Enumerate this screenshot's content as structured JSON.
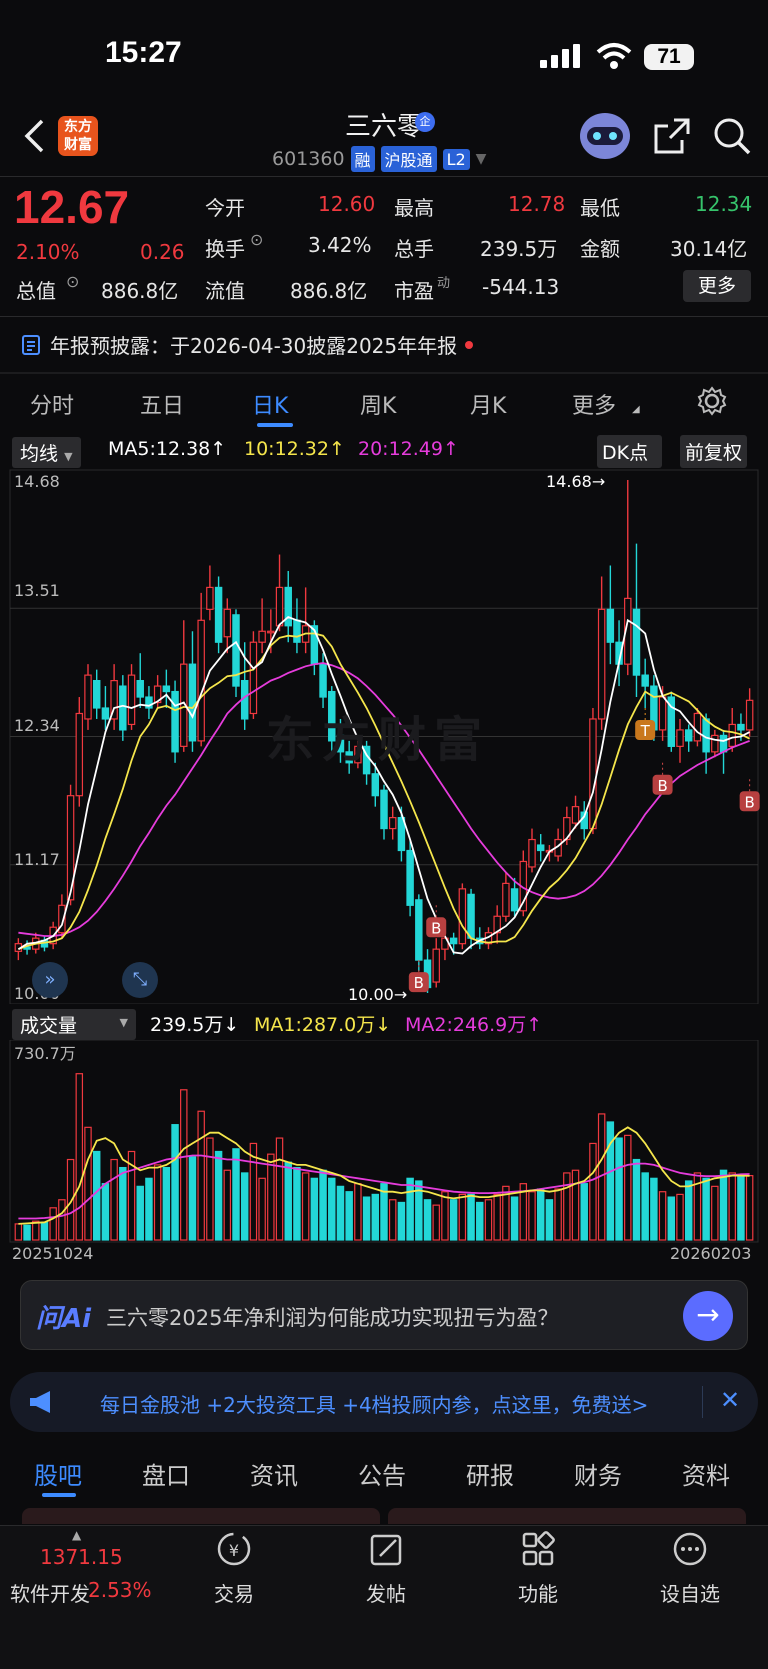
{
  "status_bar": {
    "time": "15:27",
    "battery": "71"
  },
  "header": {
    "stock_name": "三六零",
    "corp_badge": "企",
    "code": "601360",
    "tags": [
      "融",
      "沪股通",
      "L2"
    ],
    "logo_line1": "东方",
    "logo_line2": "财富"
  },
  "quote": {
    "price": "12.67",
    "change_pct": "2.10%",
    "change": "0.26",
    "fields": [
      {
        "label": "今开",
        "value": "12.60",
        "color": "red"
      },
      {
        "label": "最高",
        "value": "12.78",
        "color": "red"
      },
      {
        "label": "最低",
        "value": "12.34",
        "color": "green"
      },
      {
        "label": "换手",
        "value": "3.42%",
        "color": "white"
      },
      {
        "label": "总手",
        "value": "239.5万",
        "color": "white"
      },
      {
        "label": "金额",
        "value": "30.14亿",
        "color": "white"
      },
      {
        "label": "总值",
        "value": "886.8亿",
        "color": "white"
      },
      {
        "label": "流值",
        "value": "886.8亿",
        "color": "white"
      },
      {
        "label": "市盈",
        "label_sup": "动",
        "value": "-544.13",
        "color": "white"
      }
    ],
    "more": "更多"
  },
  "notice": {
    "text": "年报预披露：于2026-04-30披露2025年年报"
  },
  "kline_tabs": [
    "分时",
    "五日",
    "日K",
    "周K",
    "月K",
    "更多"
  ],
  "active_tab": "日K",
  "ma_bar": {
    "selector": "均线",
    "ma5": "MA5:12.38",
    "ma10": "10:12.32",
    "ma20": "20:12.49",
    "dk": "DK点",
    "adjust": "前复权"
  },
  "chart_data": [
    {
      "type": "candlestick",
      "y_ticks": [
        "14.68",
        "13.51",
        "12.34",
        "11.17",
        "10.00"
      ],
      "ylim": [
        10.0,
        14.68
      ],
      "max_label": "14.68",
      "min_label": "10.00",
      "series_colors": {
        "up": "#f0393f",
        "down": "#23d7d7",
        "ma5": "#ffffff",
        "ma10": "#f5e64c",
        "ma20": "#e63cdc"
      },
      "candles": [
        [
          10.38,
          10.45,
          10.3,
          10.5
        ],
        [
          10.42,
          10.4,
          10.35,
          10.48
        ],
        [
          10.4,
          10.5,
          10.36,
          10.55
        ],
        [
          10.48,
          10.42,
          10.38,
          10.52
        ],
        [
          10.45,
          10.6,
          10.4,
          10.65
        ],
        [
          10.55,
          10.8,
          10.5,
          10.9
        ],
        [
          10.85,
          11.8,
          10.8,
          11.9
        ],
        [
          11.8,
          12.55,
          11.7,
          12.7
        ],
        [
          12.5,
          12.9,
          12.4,
          13.0
        ],
        [
          12.85,
          12.6,
          12.5,
          12.95
        ],
        [
          12.6,
          12.5,
          12.4,
          12.8
        ],
        [
          12.5,
          12.85,
          12.4,
          13.0
        ],
        [
          12.8,
          12.4,
          12.3,
          12.9
        ],
        [
          12.45,
          12.9,
          12.4,
          13.0
        ],
        [
          12.85,
          12.7,
          12.6,
          13.1
        ],
        [
          12.7,
          12.6,
          12.5,
          12.8
        ],
        [
          12.65,
          12.8,
          12.6,
          12.9
        ],
        [
          12.8,
          12.75,
          12.6,
          12.95
        ],
        [
          12.75,
          12.2,
          12.1,
          12.85
        ],
        [
          12.25,
          13.0,
          12.2,
          13.4
        ],
        [
          13.0,
          12.3,
          12.2,
          13.3
        ],
        [
          12.3,
          13.4,
          12.25,
          13.65
        ],
        [
          13.5,
          13.7,
          13.4,
          13.9
        ],
        [
          13.7,
          13.2,
          13.1,
          13.8
        ],
        [
          13.25,
          13.5,
          13.1,
          13.6
        ],
        [
          13.45,
          12.8,
          12.7,
          13.5
        ],
        [
          12.85,
          12.5,
          12.4,
          13.2
        ],
        [
          12.55,
          13.2,
          12.5,
          13.3
        ],
        [
          13.2,
          13.3,
          13.1,
          13.6
        ],
        [
          13.3,
          13.3,
          13.1,
          13.5
        ],
        [
          13.35,
          13.7,
          13.3,
          14.0
        ],
        [
          13.7,
          13.35,
          13.2,
          13.85
        ],
        [
          13.4,
          13.2,
          13.1,
          13.6
        ],
        [
          13.2,
          13.35,
          13.1,
          13.7
        ],
        [
          13.35,
          13.0,
          12.9,
          13.4
        ],
        [
          13.0,
          12.7,
          12.6,
          13.1
        ],
        [
          12.75,
          12.3,
          12.2,
          12.8
        ],
        [
          12.35,
          12.2,
          12.1,
          12.5
        ],
        [
          12.2,
          12.1,
          12.0,
          12.3
        ],
        [
          12.1,
          12.25,
          12.05,
          12.3
        ],
        [
          12.25,
          12.0,
          11.9,
          12.3
        ],
        [
          12.0,
          11.8,
          11.7,
          12.1
        ],
        [
          11.85,
          11.5,
          11.4,
          11.9
        ],
        [
          11.5,
          11.6,
          11.4,
          11.7
        ],
        [
          11.6,
          11.3,
          11.2,
          11.7
        ],
        [
          11.3,
          10.8,
          10.7,
          11.4
        ],
        [
          10.85,
          10.3,
          10.2,
          10.9
        ],
        [
          10.3,
          10.05,
          10.0,
          10.4
        ],
        [
          10.1,
          10.4,
          10.05,
          10.5
        ],
        [
          10.4,
          10.5,
          10.3,
          10.6
        ],
        [
          10.5,
          10.45,
          10.35,
          10.55
        ],
        [
          10.45,
          10.95,
          10.4,
          11.0
        ],
        [
          10.9,
          10.5,
          10.4,
          10.95
        ],
        [
          10.5,
          10.45,
          10.4,
          10.6
        ],
        [
          10.45,
          10.55,
          10.4,
          10.6
        ],
        [
          10.55,
          10.7,
          10.45,
          10.8
        ],
        [
          10.7,
          11.0,
          10.65,
          11.1
        ],
        [
          10.95,
          10.75,
          10.7,
          11.05
        ],
        [
          10.75,
          11.2,
          10.7,
          11.3
        ],
        [
          11.15,
          11.4,
          11.1,
          11.5
        ],
        [
          11.35,
          11.3,
          11.2,
          11.45
        ],
        [
          11.3,
          11.3,
          11.2,
          11.35
        ],
        [
          11.25,
          11.4,
          11.2,
          11.5
        ],
        [
          11.4,
          11.6,
          11.35,
          11.7
        ],
        [
          11.55,
          11.7,
          11.5,
          11.8
        ],
        [
          11.65,
          11.5,
          11.4,
          11.75
        ],
        [
          11.5,
          12.5,
          11.45,
          12.6
        ],
        [
          12.5,
          13.5,
          12.4,
          13.8
        ],
        [
          13.5,
          13.2,
          13.0,
          13.9
        ],
        [
          13.2,
          13.0,
          12.8,
          13.4
        ],
        [
          13.0,
          13.6,
          12.9,
          14.68
        ],
        [
          13.5,
          12.9,
          12.7,
          14.1
        ],
        [
          12.9,
          12.8,
          12.6,
          13.05
        ],
        [
          12.8,
          12.4,
          12.3,
          12.9
        ],
        [
          12.4,
          12.7,
          12.3,
          12.8
        ],
        [
          12.7,
          12.25,
          12.2,
          12.75
        ],
        [
          12.25,
          12.4,
          12.1,
          12.5
        ],
        [
          12.4,
          12.3,
          12.2,
          12.45
        ],
        [
          12.3,
          12.55,
          12.25,
          12.6
        ],
        [
          12.5,
          12.2,
          12.0,
          12.55
        ],
        [
          12.2,
          12.35,
          12.15,
          12.4
        ],
        [
          12.35,
          12.2,
          12.0,
          12.4
        ],
        [
          12.25,
          12.45,
          12.2,
          12.6
        ],
        [
          12.45,
          12.4,
          12.3,
          12.55
        ],
        [
          12.4,
          12.67,
          12.34,
          12.78
        ]
      ],
      "ma5": [
        10.4,
        10.45,
        10.46,
        10.48,
        10.52,
        10.62,
        10.92,
        11.3,
        11.72,
        12.05,
        12.38,
        12.6,
        12.62,
        12.6,
        12.63,
        12.62,
        12.66,
        12.72,
        12.62,
        12.65,
        12.52,
        12.73,
        12.94,
        13.04,
        13.14,
        13.2,
        13.06,
        12.96,
        13.02,
        13.2,
        13.36,
        13.43,
        13.4,
        13.38,
        13.31,
        13.13,
        12.91,
        12.71,
        12.5,
        12.32,
        12.17,
        12.07,
        11.93,
        11.81,
        11.64,
        11.4,
        11.13,
        10.86,
        10.68,
        10.52,
        10.37,
        10.36,
        10.43,
        10.48,
        10.51,
        10.56,
        10.61,
        10.69,
        10.83,
        10.99,
        11.15,
        11.29,
        11.34,
        11.41,
        11.52,
        11.61,
        11.83,
        12.22,
        12.66,
        13.02,
        13.4,
        13.35,
        13.28,
        12.95,
        12.71,
        12.61,
        12.57,
        12.47,
        12.38,
        12.33,
        12.31,
        12.3,
        12.33,
        12.34,
        12.38
      ],
      "ma10": [
        10.4,
        10.43,
        10.45,
        10.46,
        10.47,
        10.5,
        10.6,
        10.74,
        10.94,
        11.16,
        11.41,
        11.63,
        11.86,
        12.12,
        12.34,
        12.45,
        12.6,
        12.62,
        12.58,
        12.61,
        12.6,
        12.7,
        12.78,
        12.83,
        12.89,
        12.9,
        12.93,
        12.95,
        13.05,
        13.17,
        13.24,
        13.26,
        13.25,
        13.28,
        13.28,
        13.26,
        13.16,
        13.0,
        12.87,
        12.74,
        12.6,
        12.44,
        12.27,
        12.1,
        11.93,
        11.75,
        11.56,
        11.36,
        11.16,
        10.96,
        10.77,
        10.61,
        10.5,
        10.47,
        10.46,
        10.47,
        10.47,
        10.51,
        10.62,
        10.75,
        10.86,
        10.96,
        11.03,
        11.12,
        11.23,
        11.37,
        11.51,
        11.72,
        11.97,
        12.22,
        12.45,
        12.61,
        12.75,
        12.7,
        12.71,
        12.74,
        12.7,
        12.66,
        12.58,
        12.49,
        12.43,
        12.39,
        12.38,
        12.36,
        12.32
      ],
      "ma20": [
        10.55,
        10.54,
        10.53,
        10.52,
        10.52,
        10.53,
        10.56,
        10.6,
        10.66,
        10.74,
        10.84,
        10.95,
        11.07,
        11.2,
        11.34,
        11.46,
        11.59,
        11.71,
        11.81,
        11.93,
        12.05,
        12.17,
        12.3,
        12.42,
        12.55,
        12.63,
        12.7,
        12.75,
        12.8,
        12.85,
        12.88,
        12.92,
        12.95,
        12.98,
        13.0,
        13.01,
        12.99,
        12.96,
        12.92,
        12.87,
        12.8,
        12.72,
        12.63,
        12.54,
        12.44,
        12.33,
        12.22,
        12.1,
        11.98,
        11.86,
        11.74,
        11.62,
        11.5,
        11.39,
        11.29,
        11.19,
        11.1,
        11.02,
        10.96,
        10.92,
        10.89,
        10.87,
        10.86,
        10.87,
        10.89,
        10.93,
        10.99,
        11.07,
        11.17,
        11.28,
        11.4,
        11.51,
        11.63,
        11.73,
        11.83,
        11.91,
        11.98,
        12.03,
        12.08,
        12.12,
        12.16,
        12.2,
        12.24,
        12.27,
        12.3
      ],
      "markers": [
        {
          "index": 46,
          "label": "B",
          "at": 10.3
        },
        {
          "index": 48,
          "label": "B",
          "at": 10.8
        },
        {
          "index": 72,
          "label": "T",
          "at": 12.6
        },
        {
          "index": 74,
          "label": "B",
          "at": 12.1
        },
        {
          "index": 84,
          "label": "B",
          "at": 11.95
        }
      ]
    },
    {
      "type": "bar",
      "title": "成交量",
      "ylim": [
        0,
        730.7
      ],
      "y_ticks": [
        "730.7万"
      ],
      "x_ticks": [
        "20251024",
        "20260203"
      ],
      "current": "239.5万",
      "ma1": "MA1:287.0万",
      "ma2": "MA2:246.9万",
      "volumes": [
        60,
        55,
        70,
        65,
        120,
        150,
        300,
        620,
        420,
        330,
        210,
        300,
        270,
        330,
        200,
        230,
        280,
        270,
        430,
        560,
        310,
        480,
        380,
        330,
        260,
        340,
        250,
        360,
        230,
        320,
        380,
        290,
        270,
        250,
        230,
        260,
        230,
        200,
        180,
        210,
        160,
        170,
        210,
        150,
        140,
        230,
        220,
        150,
        130,
        180,
        150,
        170,
        170,
        140,
        150,
        170,
        200,
        160,
        210,
        180,
        190,
        150,
        190,
        250,
        260,
        210,
        360,
        470,
        440,
        380,
        390,
        300,
        250,
        230,
        180,
        160,
        170,
        220,
        250,
        230,
        200,
        260,
        250,
        240,
        240
      ],
      "vol_up": [
        1,
        0,
        1,
        0,
        1,
        1,
        1,
        1,
        1,
        0,
        0,
        1,
        0,
        1,
        0,
        0,
        1,
        0,
        0,
        1,
        0,
        1,
        1,
        0,
        1,
        0,
        0,
        1,
        1,
        1,
        1,
        0,
        0,
        1,
        0,
        0,
        0,
        0,
        0,
        1,
        0,
        0,
        0,
        1,
        0,
        0,
        0,
        0,
        1,
        1,
        0,
        1,
        0,
        0,
        1,
        1,
        1,
        0,
        1,
        1,
        0,
        0,
        1,
        1,
        1,
        0,
        1,
        1,
        0,
        0,
        1,
        0,
        0,
        0,
        1,
        0,
        1,
        0,
        1,
        0,
        1,
        0,
        1,
        0,
        1
      ],
      "vol_ma1": [
        60,
        62,
        64,
        66,
        80,
        100,
        140,
        200,
        300,
        370,
        380,
        360,
        300,
        280,
        260,
        270,
        270,
        280,
        300,
        340,
        360,
        380,
        400,
        400,
        380,
        360,
        330,
        310,
        300,
        290,
        300,
        290,
        280,
        280,
        270,
        260,
        250,
        240,
        220,
        210,
        200,
        190,
        180,
        180,
        175,
        180,
        185,
        180,
        170,
        160,
        155,
        160,
        165,
        160,
        160,
        165,
        170,
        175,
        180,
        185,
        185,
        180,
        185,
        195,
        210,
        220,
        250,
        300,
        360,
        400,
        420,
        400,
        360,
        310,
        260,
        220,
        200,
        200,
        210,
        220,
        230,
        235,
        240,
        240,
        239
      ],
      "vol_ma2": [
        80,
        80,
        80,
        82,
        85,
        90,
        100,
        120,
        150,
        180,
        210,
        230,
        250,
        260,
        270,
        280,
        290,
        300,
        305,
        310,
        315,
        315,
        310,
        305,
        300,
        300,
        295,
        290,
        285,
        280,
        275,
        270,
        265,
        260,
        255,
        250,
        245,
        240,
        235,
        230,
        225,
        220,
        215,
        210,
        205,
        205,
        200,
        195,
        190,
        185,
        180,
        178,
        176,
        175,
        175,
        176,
        178,
        180,
        182,
        185,
        190,
        195,
        200,
        205,
        210,
        215,
        225,
        240,
        255,
        270,
        280,
        285,
        285,
        280,
        270,
        260,
        250,
        245,
        240,
        238,
        238,
        240,
        242,
        245,
        246
      ]
    }
  ],
  "ai": {
    "logo": "问Ai",
    "question": "三六零2025年净利润为何能成功实现扭亏为盈？"
  },
  "promo": {
    "text": "每日金股池 +2大投资工具 +4档投顾内参，点这里，免费送>"
  },
  "bottom_tabs": [
    "股吧",
    "盘口",
    "资讯",
    "公告",
    "研报",
    "财务",
    "资料"
  ],
  "nav": {
    "index_value": "1371.15",
    "index_name": "软件开发",
    "index_pct": "2.53%",
    "items": [
      {
        "label": "交易",
        "icon": "trade-icon"
      },
      {
        "label": "发帖",
        "icon": "post-icon"
      },
      {
        "label": "功能",
        "icon": "apps-icon"
      },
      {
        "label": "设自选",
        "icon": "more-icon"
      }
    ]
  }
}
